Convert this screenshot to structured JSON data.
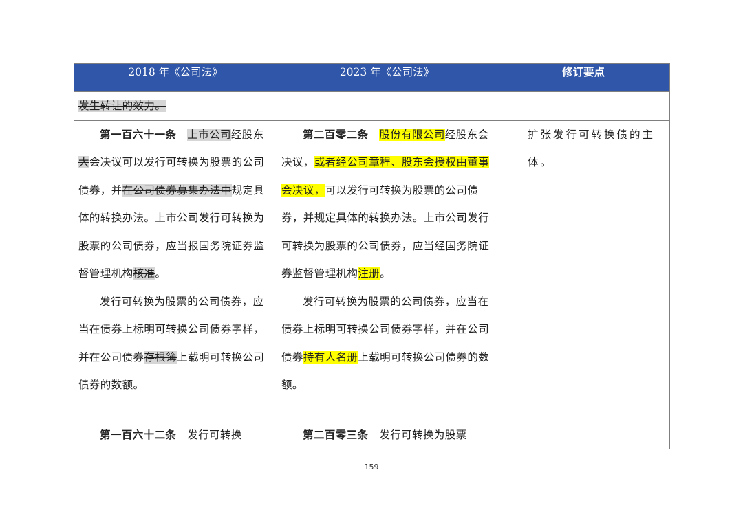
{
  "header": {
    "col1": "2018 年《公司法》",
    "col2": "2023 年《公司法》",
    "col3": "修订要点"
  },
  "row_top": {
    "col1": "发生转让的效力。"
  },
  "row_main": {
    "col1": {
      "article": "第一百六十一条",
      "seg1_del": "上市公司",
      "seg2": "经股东",
      "seg3_del": "大",
      "seg4": "会决议可以发行可转换为股票的公司债券，并",
      "seg5_del": "在公司债券募集办法中",
      "seg6": "规定具体的转换办法。上市公司发行可转换为股票的公司债券，应当报国务院证券监督管理机构",
      "seg7_del": "核准",
      "seg8": "。",
      "para2_a": "发行可转换为股票的公司债券，应当在债券上标明可转换公司债券字样，并在公司债券",
      "para2_del": "存根簿",
      "para2_b": "上载明可转换公司债券的数额。"
    },
    "col2": {
      "article": "第二百零二条",
      "seg1_hl": "股份有限公司",
      "seg2": "经股东会决议，",
      "seg3_hl": "或者经公司章程、股东会授权由董事会决议，",
      "seg4": "可以发行可转换为股票的公司债券，并规定具体的转换办法。上市公司发行可转换为股票的公司债券，应当经国务院证券监督管理机构",
      "seg5_hl": "注册",
      "seg6": "。",
      "para2_a": "发行可转换为股票的公司债券，应当在债券上标明可转换公司债券字样，并在公司债券",
      "para2_hl": "持有人名册",
      "para2_b": "上载明可转换公司债券的数额。"
    },
    "col3": "扩张发行可转换债的主体。"
  },
  "row_last": {
    "col1_article": "第一百六十二条",
    "col1_text": "发行可转换",
    "col2_article": "第二百零三条",
    "col2_text": "发行可转换为股票"
  },
  "page_number": "159",
  "colors": {
    "header_bg": "#2f56a8",
    "highlight": "#ffff00",
    "deleted_shade": "#d6d6d6"
  }
}
